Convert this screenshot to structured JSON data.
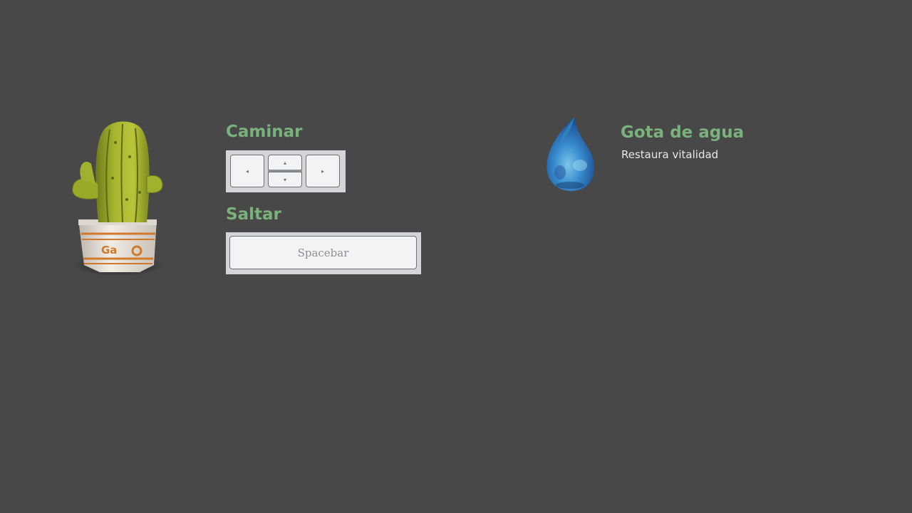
{
  "controls": {
    "walk_title": "Caminar",
    "jump_title": "Saltar",
    "keys": {
      "left_glyph": "◂",
      "up_glyph": "▴",
      "down_glyph": "▾",
      "right_glyph": "▸",
      "spacebar_label": "Spacebar"
    }
  },
  "item": {
    "name": "Gota de agua",
    "description": "Restaura vitalidad",
    "icon": "water-drop-icon"
  },
  "character": {
    "icon": "cactus-icon"
  },
  "colors": {
    "background": "#484848",
    "title_green": "#79b27a",
    "key_panel": "#d3d5d9",
    "key_face": "#f3f3f4"
  }
}
